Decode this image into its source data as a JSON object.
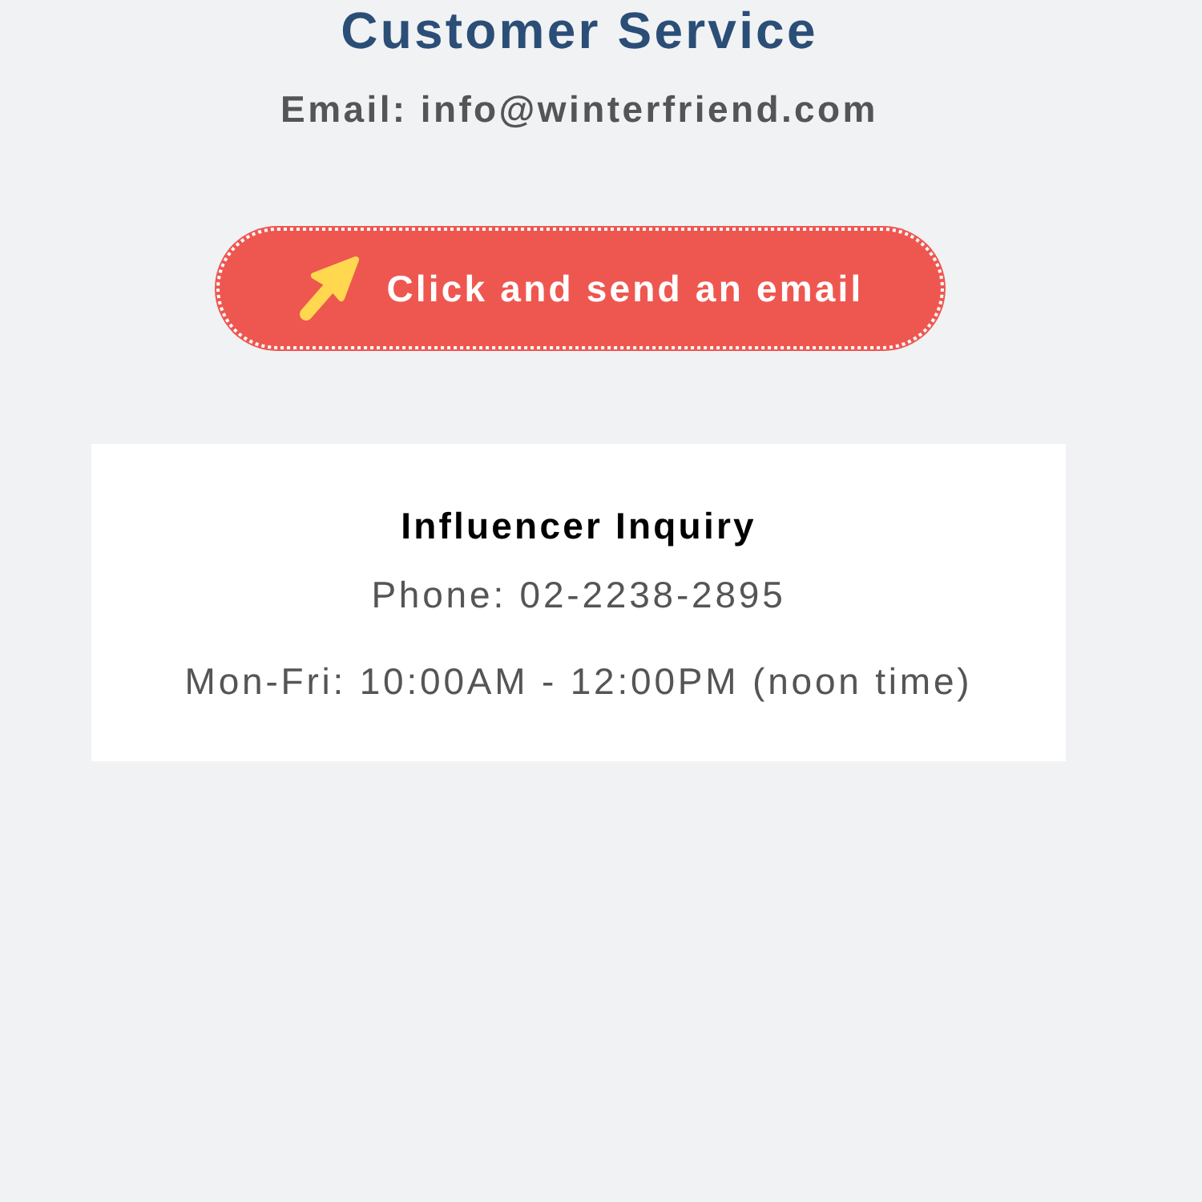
{
  "header": {
    "title": "Customer Service",
    "email": "Email: info@winterfriend.com"
  },
  "email_button": {
    "label": "Click and send an email"
  },
  "card": {
    "title": "Influencer Inquiry",
    "lines": [
      "Phone: 02-2238-2895",
      "Mon-Fri: 10:00AM - 12:00PM (noon time)"
    ]
  }
}
